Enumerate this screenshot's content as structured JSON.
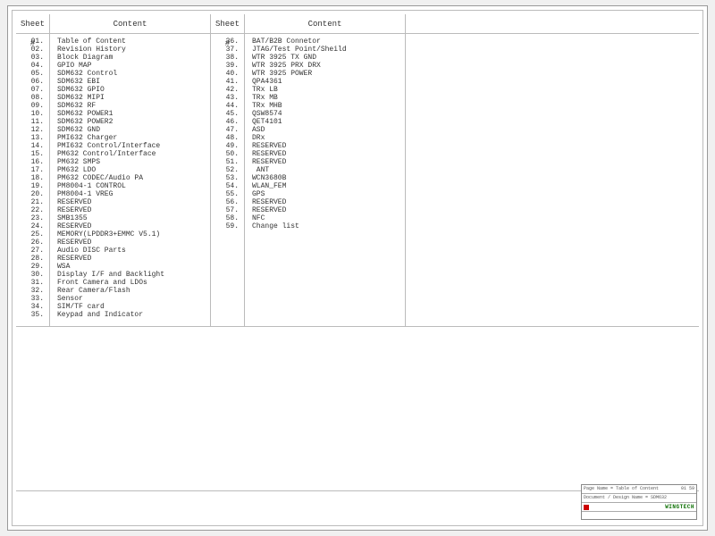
{
  "headers": {
    "sheet": "Sheet #",
    "content": "Content"
  },
  "column1": [
    {
      "n": "01.",
      "t": "Table of Content"
    },
    {
      "n": "02.",
      "t": "Revision History"
    },
    {
      "n": "03.",
      "t": "Block Diagram"
    },
    {
      "n": "04.",
      "t": "GPIO MAP"
    },
    {
      "n": "05.",
      "t": "SDM632 Control"
    },
    {
      "n": "06.",
      "t": "SDM632 EBI"
    },
    {
      "n": "07.",
      "t": "SDM632 GPIO"
    },
    {
      "n": "08.",
      "t": "SDM632 MIPI"
    },
    {
      "n": "09.",
      "t": "SDM632 RF"
    },
    {
      "n": "10.",
      "t": "SDM632 POWER1"
    },
    {
      "n": "11.",
      "t": "SDM632 POWER2"
    },
    {
      "n": "12.",
      "t": "SDM632 GND"
    },
    {
      "n": "13.",
      "t": "PMI632 Charger"
    },
    {
      "n": "14.",
      "t": "PMI632 Control/Interface"
    },
    {
      "n": "15.",
      "t": "PM632 Control/Interface"
    },
    {
      "n": "16.",
      "t": "PM632 SMPS"
    },
    {
      "n": "17.",
      "t": "PM632 LDO"
    },
    {
      "n": "18.",
      "t": "PM632 CODEC/Audio PA"
    },
    {
      "n": "19.",
      "t": "PM8004-1 CONTROL"
    },
    {
      "n": "20.",
      "t": "PM8004-1 VREG"
    },
    {
      "n": "21.",
      "t": "RESERVED"
    },
    {
      "n": "22.",
      "t": "RESERVED"
    },
    {
      "n": "23.",
      "t": "SMB1355"
    },
    {
      "n": "24.",
      "t": "RESERVED"
    },
    {
      "n": "25.",
      "t": "MEMORY(LPDDR3+EMMC V5.1)"
    },
    {
      "n": "26.",
      "t": "RESERVED"
    },
    {
      "n": "27.",
      "t": "Audio DISC Parts"
    },
    {
      "n": "28.",
      "t": "RESERVED"
    },
    {
      "n": "29.",
      "t": "WSA"
    },
    {
      "n": "30.",
      "t": "Display I/F and Backlight"
    },
    {
      "n": "31.",
      "t": "Front Camera and LDOs"
    },
    {
      "n": "32.",
      "t": "Rear Camera/Flash"
    },
    {
      "n": "33.",
      "t": "Sensor"
    },
    {
      "n": "34.",
      "t": "SIM/TF card"
    },
    {
      "n": "35.",
      "t": "Keypad and Indicator"
    }
  ],
  "column2": [
    {
      "n": "36.",
      "t": "BAT/B2B Connetor"
    },
    {
      "n": "37.",
      "t": "JTAG/Test Point/Sheild"
    },
    {
      "n": "38.",
      "t": "WTR 3925 TX GND"
    },
    {
      "n": "39.",
      "t": "WTR 3925 PRX DRX"
    },
    {
      "n": "40.",
      "t": "WTR 3925 POWER"
    },
    {
      "n": "41.",
      "t": "QPA4361"
    },
    {
      "n": "42.",
      "t": "TRx LB"
    },
    {
      "n": "43.",
      "t": "TRx MB"
    },
    {
      "n": "44.",
      "t": "TRx MHB"
    },
    {
      "n": "45.",
      "t": "QSW8574"
    },
    {
      "n": "46.",
      "t": "QET4101"
    },
    {
      "n": "47.",
      "t": "ASD"
    },
    {
      "n": "48.",
      "t": "DRx"
    },
    {
      "n": "49.",
      "t": "RESERVED"
    },
    {
      "n": "50.",
      "t": "RESERVED"
    },
    {
      "n": "51.",
      "t": "RESERVED"
    },
    {
      "n": "52.",
      "t": " ANT"
    },
    {
      "n": "53.",
      "t": "WCN3680B"
    },
    {
      "n": "54.",
      "t": "WLAN_FEM"
    },
    {
      "n": "55.",
      "t": "GPS"
    },
    {
      "n": "56.",
      "t": "RESERVED"
    },
    {
      "n": "57.",
      "t": "RESERVED"
    },
    {
      "n": "58.",
      "t": "NFC"
    },
    {
      "n": "59.",
      "t": "Change list"
    }
  ],
  "titleblock": {
    "row1_left": "Page Name = Table of Content",
    "row1_right": "01  59",
    "row2": "Document / Design Name = SDM632",
    "brand": "WINGTECH",
    "row4_left": "",
    "row4_right": ""
  }
}
